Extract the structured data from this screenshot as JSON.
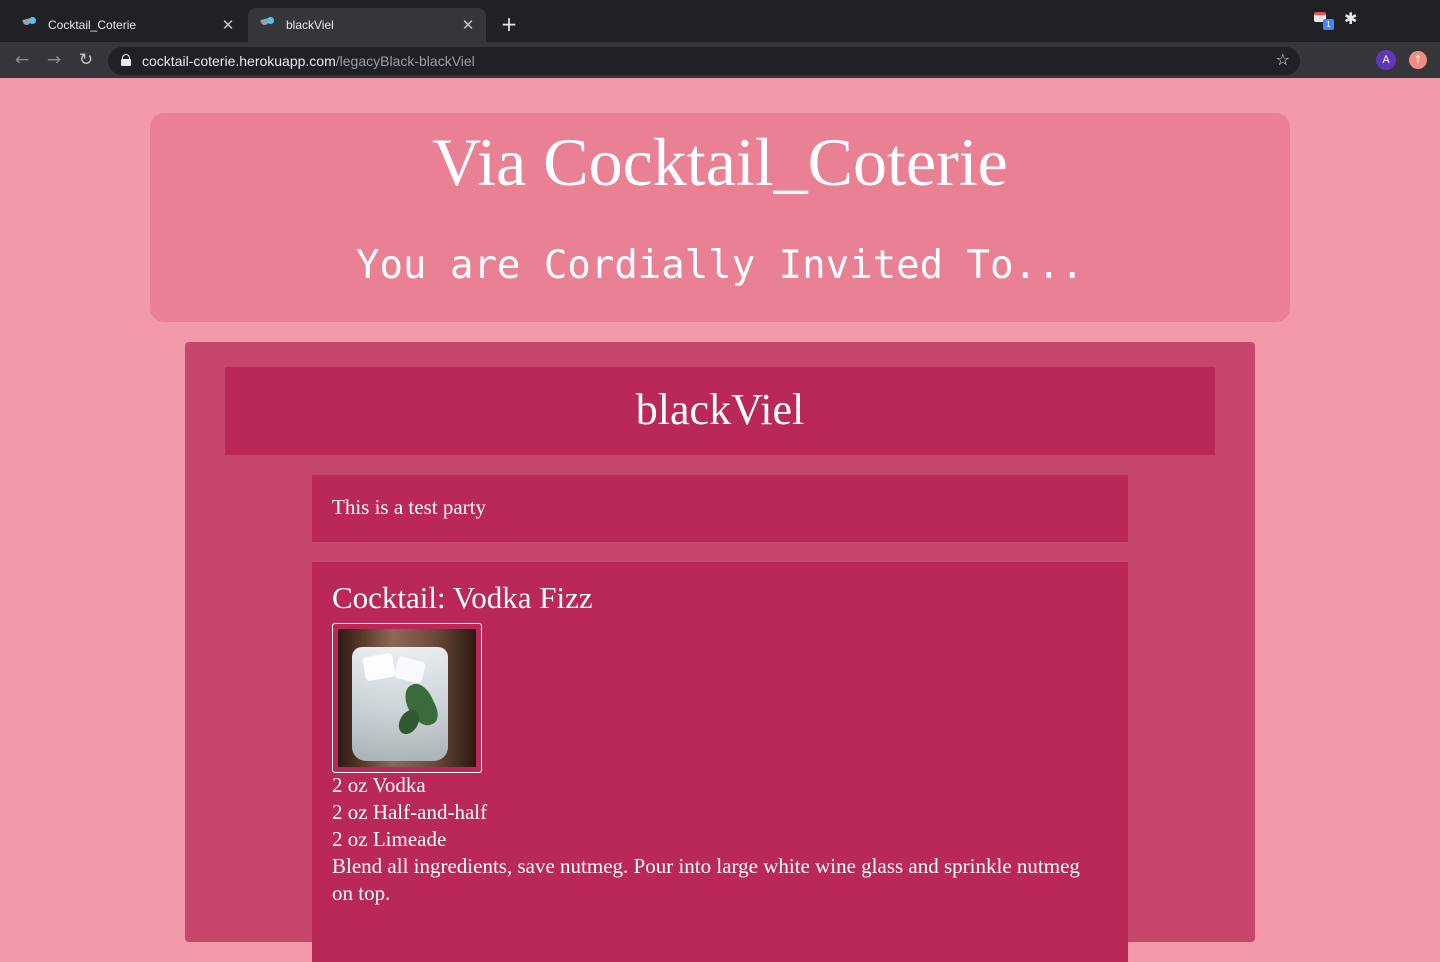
{
  "browser": {
    "tabs": [
      {
        "title": "Cocktail_Coterie",
        "active": false
      },
      {
        "title": "blackViel",
        "active": true
      }
    ],
    "url_host": "cocktail-coterie.herokuapp.com",
    "url_path": "/legacyBlack-blackViel",
    "extension_badge": "1",
    "avatar_letter": "A"
  },
  "header": {
    "site_title": "Via Cocktail_Coterie",
    "tagline": "You are Cordially Invited To..."
  },
  "party": {
    "name": "blackViel",
    "description": "This is a test party"
  },
  "cocktail": {
    "title": "Cocktail: Vodka Fizz",
    "ingredients": [
      "2 oz Vodka",
      "2 oz Half-and-half",
      "2 oz Limeade"
    ],
    "instructions": "Blend all ingredients, save nutmeg. Pour into large white wine glass and sprinkle nutmeg on top."
  },
  "colors": {
    "page_bg": "#f29aaa",
    "header_card": "#e98094",
    "main_card": "#c7466c",
    "content_box": "#b92857"
  }
}
